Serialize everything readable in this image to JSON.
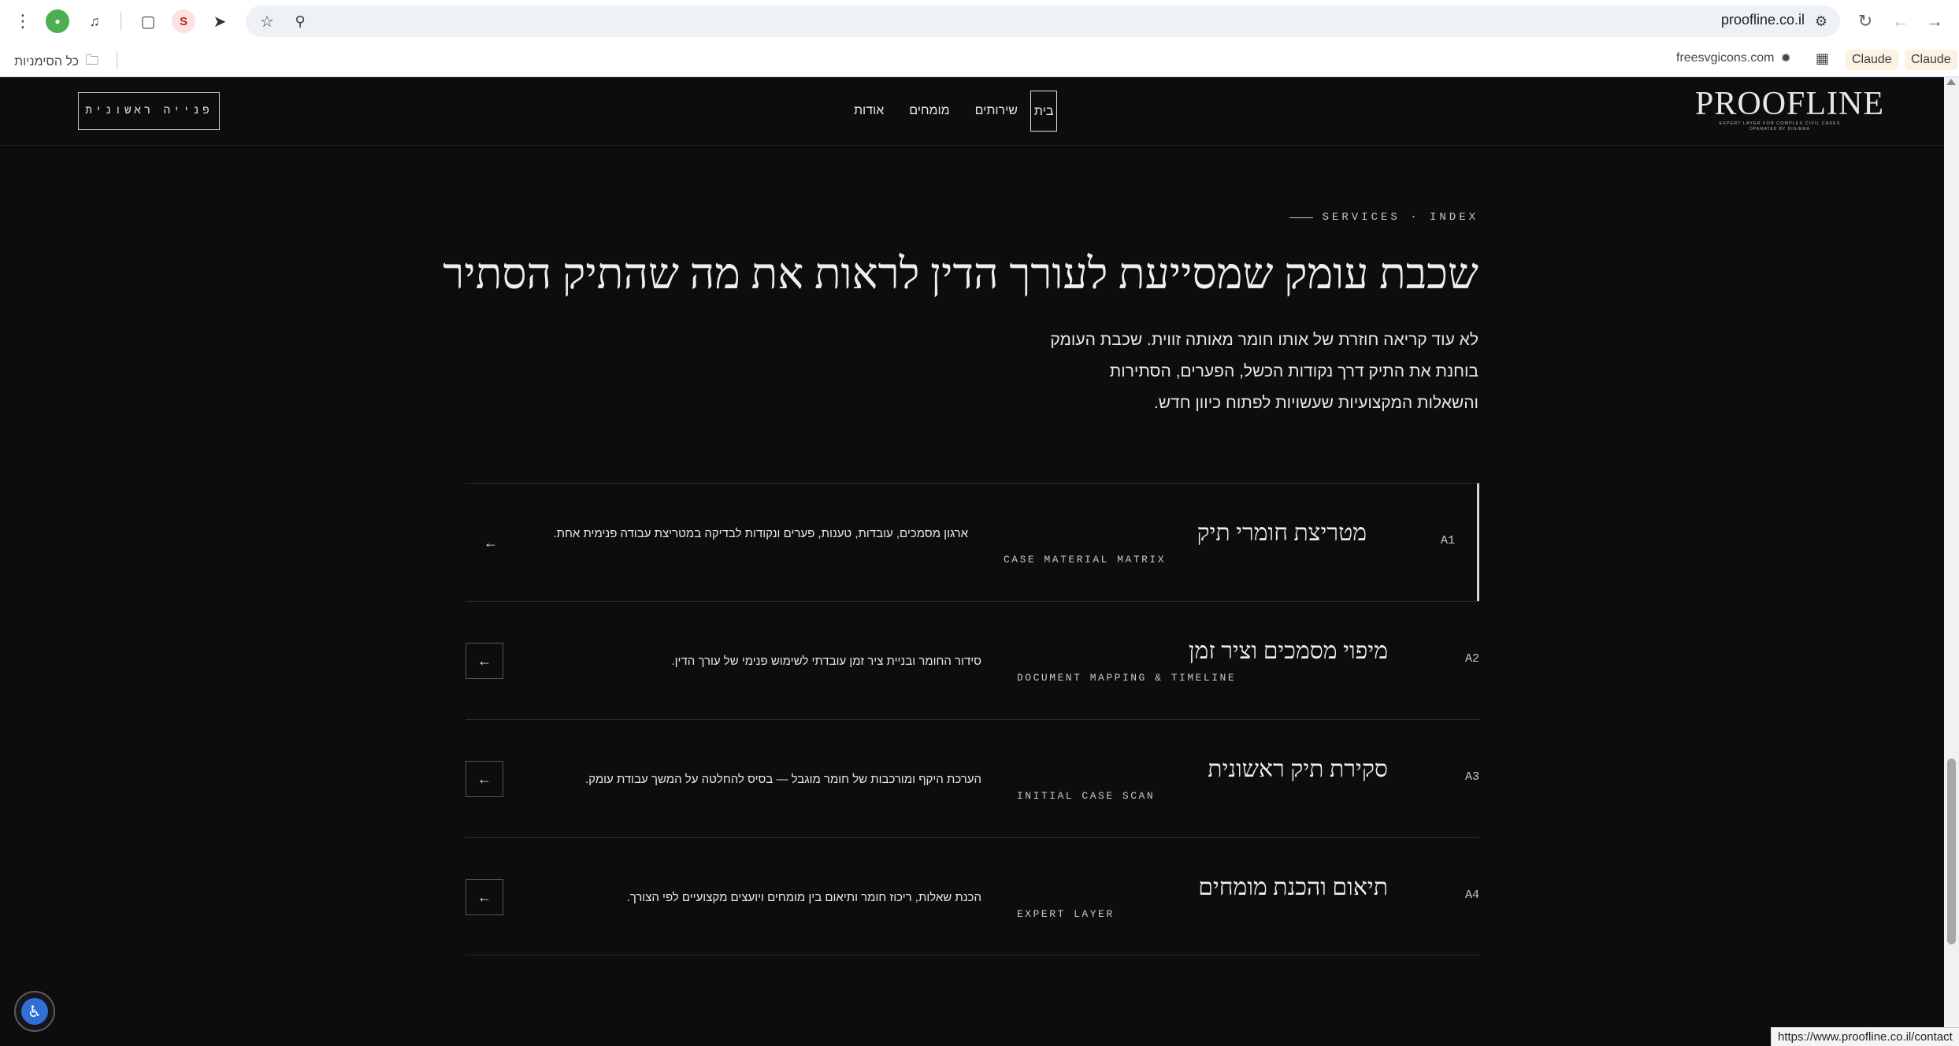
{
  "browser": {
    "url": "proofline.co.il",
    "bookmarks": {
      "all_bookmarks": "כל הסימניות",
      "freesvgicons": "freesvgicons.com",
      "claude_1": "Claude",
      "claude_2": "Claude"
    },
    "status_url": "https://www.proofline.co.il/contact"
  },
  "header": {
    "logo": "PROOFLINE",
    "logo_tagline": "EXPERT LAYER FOR COMPLEX CIVIL CASES",
    "logo_tagline2": "OPERATED BY DIGIEMA",
    "cta_label": "פנייה ראשונית",
    "nav": [
      {
        "label": "בית",
        "active": true
      },
      {
        "label": "שירותים"
      },
      {
        "label": "מומחים"
      },
      {
        "label": "אודות"
      }
    ]
  },
  "section": {
    "eyebrow": "SERVICES · INDEX",
    "heading": "שכבת עומק שמסייעת לעורך הדין לראות את מה שהתיק הסתיר",
    "intro_lines": [
      "לא עוד קריאה חוזרת של אותו חומר מאותה זווית. שכבת העומק",
      "בוחנת את התיק דרך נקודות הכשל, הפערים, הסתירות",
      "והשאלות המקצועיות שעשויות לפתוח כיוון חדש."
    ]
  },
  "services": [
    {
      "code": "A1",
      "title": "מטריצת חומרי תיק",
      "subtitle": "CASE MATERIAL MATRIX",
      "description": "ארגון מסמכים, עובדות, טענות, פערים ונקודות לבדיקה במטריצת עבודה פנימית אחת.",
      "arrow": "←"
    },
    {
      "code": "A2",
      "title": "מיפוי מסמכים וציר זמן",
      "subtitle": "DOCUMENT MAPPING & TIMELINE",
      "description": "סידור החומר ובניית ציר זמן עובדתי לשימוש פנימי של עורך הדין.",
      "arrow": "←"
    },
    {
      "code": "A3",
      "title": "סקירת תיק ראשונית",
      "subtitle": "INITIAL CASE SCAN",
      "description": "הערכת היקף ומורכבות של חומר מוגבל — בסיס להחלטה על המשך עבודת עומק.",
      "arrow": "←"
    },
    {
      "code": "A4",
      "title": "תיאום והכנת מומחים",
      "subtitle": "EXPERT LAYER",
      "description": "הכנת שאלות, ריכוז חומר ותיאום בין מומחים ויועצים מקצועיים לפי הצורך.",
      "arrow": "←"
    }
  ],
  "icons": {
    "menu": "vertical-dots-icon",
    "accessibility": "accessibility-icon"
  }
}
